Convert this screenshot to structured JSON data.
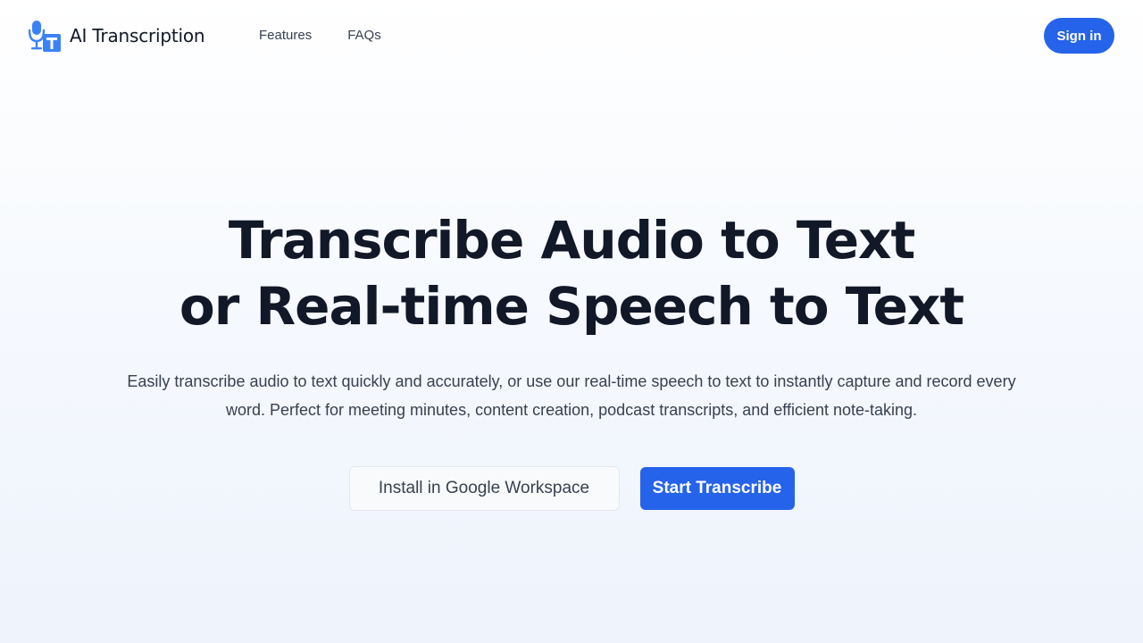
{
  "header": {
    "brand": "AI Transcription",
    "logo_icon": "microphone-text-icon",
    "nav": [
      "Features",
      "FAQs"
    ],
    "signin_label": "Sign in"
  },
  "hero": {
    "title_line1": "Transcribe Audio to Text",
    "title_line2": "or Real-time Speech to Text",
    "subtitle": "Easily transcribe audio to text quickly and accurately, or use our real-time speech to text to instantly capture and record every word. Perfect for meeting minutes, content creation, podcast transcripts, and efficient note-taking.",
    "secondary_cta": "Install in Google Workspace",
    "primary_cta": "Start Transcribe"
  },
  "colors": {
    "accent": "#2563eb",
    "text_dark": "#111827",
    "text_body": "#374151"
  }
}
